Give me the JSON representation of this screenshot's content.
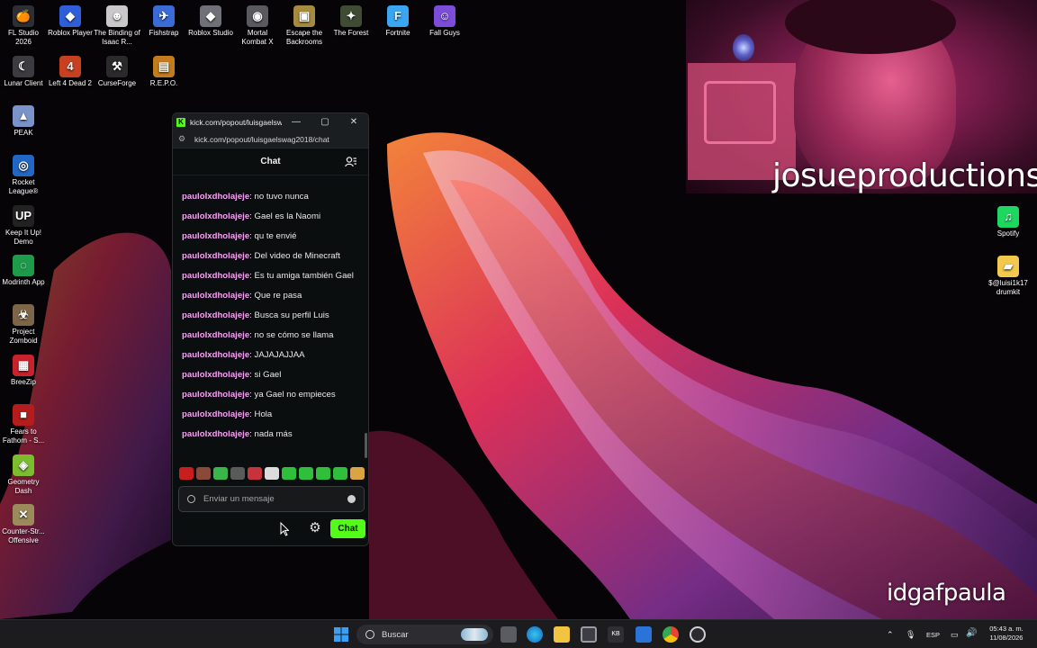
{
  "desktop": {
    "icons": [
      {
        "label": "FL Studio 2026",
        "glyph": "🍊",
        "color": "#2d2f36"
      },
      {
        "label": "Roblox Player",
        "glyph": "◆",
        "color": "#2f5fd8"
      },
      {
        "label": "The Binding of Isaac R...",
        "glyph": "☻",
        "color": "#c9c9c9"
      },
      {
        "label": "Fishstrap",
        "glyph": "✈",
        "color": "#3a6bd6"
      },
      {
        "label": "Roblox Studio",
        "glyph": "◆",
        "color": "#707078"
      },
      {
        "label": "Mortal Kombat X",
        "glyph": "◉",
        "color": "#5a5a5e"
      },
      {
        "label": "Escape the Backrooms",
        "glyph": "▣",
        "color": "#a58b3f"
      },
      {
        "label": "The Forest",
        "glyph": "✦",
        "color": "#3f4b33"
      },
      {
        "label": "Fortnite",
        "glyph": "F",
        "color": "#3aa6f2"
      },
      {
        "label": "Fall Guys",
        "glyph": "☺",
        "color": "#7b4dd8"
      },
      {
        "label": "Lunar Client",
        "glyph": "☾",
        "color": "#3b3b40"
      },
      {
        "label": "Left 4 Dead 2",
        "glyph": "4",
        "color": "#c7401f"
      },
      {
        "label": "CurseForge",
        "glyph": "⚒",
        "color": "#2a2a2a"
      },
      {
        "label": "R.E.P.O.",
        "glyph": "▤",
        "color": "#c27c1e"
      },
      {
        "label": "PEAK",
        "glyph": "▲",
        "color": "#7a93c8"
      },
      {
        "label": "Rocket League®",
        "glyph": "◎",
        "color": "#2367c4"
      },
      {
        "label": "Keep It Up! Demo",
        "glyph": "UP",
        "color": "#222"
      },
      {
        "label": "Modrinth App",
        "glyph": "◌",
        "color": "#1e9b4a"
      },
      {
        "label": "Project Zomboid",
        "glyph": "☣",
        "color": "#7d6548"
      },
      {
        "label": "BreeZip",
        "glyph": "▦",
        "color": "#c8232d"
      },
      {
        "label": "Fears to Fathom - S...",
        "glyph": "■",
        "color": "#b51c1c"
      },
      {
        "label": "Geometry Dash",
        "glyph": "◈",
        "color": "#7bbd2e"
      },
      {
        "label": "Counter-Str... Offensive",
        "glyph": "✕",
        "color": "#9c8a5a"
      },
      {
        "label": "Spotify",
        "glyph": "♫",
        "color": "#1ed760"
      },
      {
        "label": "$@luisi1k17 drumkit",
        "glyph": "▰",
        "color": "#f2c94c"
      }
    ]
  },
  "overlay": {
    "streamer_name": "josueproductions",
    "signature": "idgafpaula"
  },
  "chat_window": {
    "title": "kick.com/popout/luisgaelsw...",
    "url": "kick.com/popout/luisgaelswag2018/chat",
    "header_title": "Chat",
    "messages": [
      {
        "user": "pauloIxdholajeje",
        "text": "no tuvo nunca"
      },
      {
        "user": "pauloIxdholajeje",
        "text": "Gael es la Naomi"
      },
      {
        "user": "pauloIxdholajeje",
        "text": "qu te envié"
      },
      {
        "user": "pauloIxdholajeje",
        "text": "Del video de Minecraft"
      },
      {
        "user": "pauloIxdholajeje",
        "text": "Es tu amiga también Gael"
      },
      {
        "user": "pauloIxdholajeje",
        "text": "Que re pasa"
      },
      {
        "user": "pauloIxdholajeje",
        "text": "Busca su perfil Luis"
      },
      {
        "user": "pauloIxdholajeje",
        "text": "no se cómo se llama"
      },
      {
        "user": "pauloIxdholajeje",
        "text": "JAJAJAJJAA"
      },
      {
        "user": "pauloIxdholajeje",
        "text": "si Gael"
      },
      {
        "user": "pauloIxdholajeje",
        "text": "ya Gael no empieces"
      },
      {
        "user": "pauloIxdholajeje",
        "text": "Hola"
      },
      {
        "user": "pauloIxdholajeje",
        "text": "nada más"
      }
    ],
    "emote_colors": [
      "#c81e1e",
      "#8a4a3a",
      "#3ab54a",
      "#5a5a5a",
      "#c8323c",
      "#dcdcdc",
      "#2fbf3a",
      "#2fbf3a",
      "#2fbf3a",
      "#2fbf3a",
      "#d9a441"
    ],
    "input_placeholder": "Enviar un mensaje",
    "send_label": "Chat",
    "accent": "#53fc18",
    "username_color": "#f4a2f1"
  },
  "taskbar": {
    "search_label": "Buscar",
    "language": "ESP",
    "time": "05:43 a. m.",
    "date": "11/08/2026"
  }
}
